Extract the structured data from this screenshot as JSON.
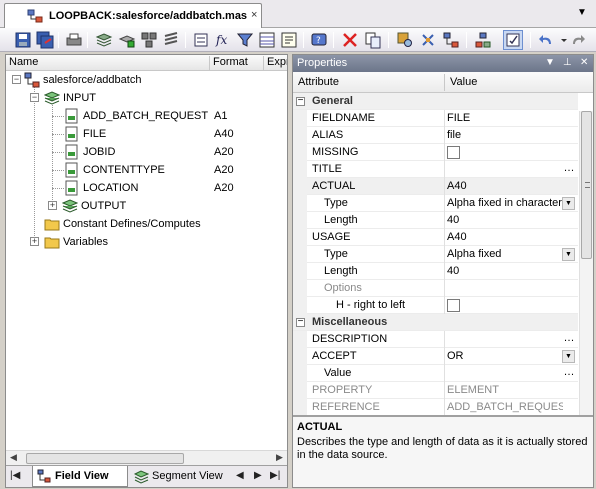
{
  "tab": {
    "title": "LOOPBACK:salesforce/addbatch.mas",
    "close": "×",
    "menu_glyph": "▼"
  },
  "toolbar": {
    "icons": [
      "save-icon",
      "save-all-icon",
      "print-icon",
      "segment-icon",
      "field-icon",
      "group-icon",
      "filter-icon",
      "list-icon",
      "fx-icon",
      "filter-icon",
      "table-icon",
      "dialog-icon",
      "help-icon",
      "delete-icon",
      "copy-icon",
      "search-icon",
      "tree-icon",
      "join-icon",
      "hierarchy-icon",
      "properties-icon",
      "undo-icon",
      "redo-icon"
    ]
  },
  "tree": {
    "columns": [
      "Name",
      "Format",
      "Expr"
    ],
    "root": "salesforce/addbatch",
    "input": "INPUT",
    "fields": [
      {
        "name": "ADD_BATCH_REQUEST",
        "format": "A1"
      },
      {
        "name": "FILE",
        "format": "A40"
      },
      {
        "name": "JOBID",
        "format": "A20"
      },
      {
        "name": "CONTENTTYPE",
        "format": "A20"
      },
      {
        "name": "LOCATION",
        "format": "A20"
      }
    ],
    "output": "OUTPUT",
    "constants": "Constant Defines/Computes",
    "variables": "Variables"
  },
  "bottom_tabs": {
    "field_view": "Field View",
    "segment_view": "Segment View"
  },
  "properties": {
    "title": "Properties",
    "header": {
      "attribute": "Attribute",
      "value": "Value"
    },
    "general": "General",
    "rows": [
      {
        "name": "FIELDNAME",
        "value": "FILE"
      },
      {
        "name": "ALIAS",
        "value": "file"
      },
      {
        "name": "MISSING",
        "value": ""
      },
      {
        "name": "TITLE",
        "value": ""
      },
      {
        "name": "ACTUAL",
        "value": "A40"
      },
      {
        "name": "Type",
        "value": "Alpha fixed in character"
      },
      {
        "name": "Length",
        "value": "40"
      },
      {
        "name": "USAGE",
        "value": "A40"
      },
      {
        "name": "Type",
        "value": "Alpha fixed"
      },
      {
        "name": "Length",
        "value": "40"
      },
      {
        "name": "Options",
        "value": ""
      },
      {
        "name": "H - right to left",
        "value": ""
      }
    ],
    "misc": "Miscellaneous",
    "misc_rows": [
      {
        "name": "DESCRIPTION",
        "value": ""
      },
      {
        "name": "ACCEPT",
        "value": "OR"
      },
      {
        "name": "Value",
        "value": ""
      },
      {
        "name": "PROPERTY",
        "value": "ELEMENT"
      },
      {
        "name": "REFERENCE",
        "value": "ADD_BATCH_REQUEST"
      }
    ],
    "description": {
      "title": "ACTUAL",
      "text": "Describes the type and length of data as it is actually stored in the data source."
    }
  },
  "colors": {
    "accent": "#6c7589",
    "panel_border": "#8c8c8c"
  }
}
